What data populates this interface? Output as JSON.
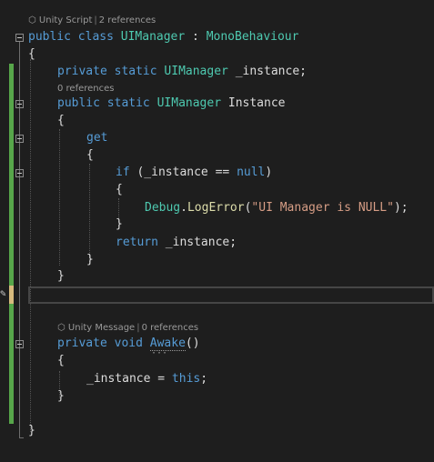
{
  "lens": {
    "class": {
      "icon": "unity-cube-icon",
      "kind": "Unity Script",
      "refs": "2 references"
    },
    "instance": {
      "refs": "0 references"
    },
    "awake": {
      "icon": "unity-cube-icon",
      "kind": "Unity Message",
      "refs": "0 references"
    }
  },
  "code": {
    "l1": {
      "kw1": "public",
      "kw2": "class",
      "name": "UIManager",
      "colon": " : ",
      "base": "MonoBehaviour"
    },
    "l2": "{",
    "l3": {
      "kw1": "private",
      "kw2": "static",
      "type": "UIManager",
      "rest": " _instance;"
    },
    "l4": {
      "kw1": "public",
      "kw2": "static",
      "type": "UIManager",
      "rest": " Instance"
    },
    "l5": "{",
    "l6": "get",
    "l7": "{",
    "l8": {
      "kw": "if",
      "mid": " (_instance == ",
      "null": "null",
      "end": ")"
    },
    "l9": "{",
    "l10": {
      "obj": "Debug",
      "dot": ".",
      "meth": "LogError",
      "open": "(",
      "str": "\"UI Manager is NULL\"",
      "close": ");"
    },
    "l11": "}",
    "l12": {
      "kw": "return",
      "rest": " _instance;"
    },
    "l13": "}",
    "l14": "}",
    "l15": {
      "kw1": "private",
      "kw2": "void",
      "meth": "Awake",
      "rest": "()"
    },
    "l16": "{",
    "l17": {
      "a": "_instance = ",
      "kw": "this",
      "b": ";"
    },
    "l18": "}",
    "l19": "}"
  },
  "colors": {
    "keyword": "#569cd6",
    "type": "#4ec9b0",
    "string": "#d69d85",
    "method": "#dcdcaa",
    "changed": "#57a64a",
    "unsaved": "#d7ba7d"
  }
}
